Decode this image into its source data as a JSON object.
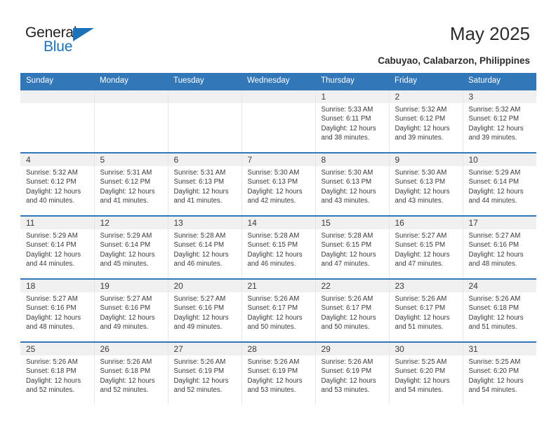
{
  "brand": {
    "name_top": "General",
    "name_bottom": "Blue",
    "triangle_icon": "triangle-icon",
    "accent_color": "#1c72b8"
  },
  "header": {
    "title": "May 2025",
    "subtitle": "Cabuyao, Calabarzon, Philippines"
  },
  "calendar": {
    "header_bg": "#3277b8",
    "daynum_bg": "#f0f0f0",
    "weekdays": [
      "Sunday",
      "Monday",
      "Tuesday",
      "Wednesday",
      "Thursday",
      "Friday",
      "Saturday"
    ],
    "weeks": [
      [
        {
          "day": "",
          "empty": true
        },
        {
          "day": "",
          "empty": true
        },
        {
          "day": "",
          "empty": true
        },
        {
          "day": "",
          "empty": true
        },
        {
          "day": "1",
          "sunrise": "Sunrise: 5:33 AM",
          "sunset": "Sunset: 6:11 PM",
          "daylight1": "Daylight: 12 hours",
          "daylight2": "and 38 minutes."
        },
        {
          "day": "2",
          "sunrise": "Sunrise: 5:32 AM",
          "sunset": "Sunset: 6:12 PM",
          "daylight1": "Daylight: 12 hours",
          "daylight2": "and 39 minutes."
        },
        {
          "day": "3",
          "sunrise": "Sunrise: 5:32 AM",
          "sunset": "Sunset: 6:12 PM",
          "daylight1": "Daylight: 12 hours",
          "daylight2": "and 39 minutes."
        }
      ],
      [
        {
          "day": "4",
          "sunrise": "Sunrise: 5:32 AM",
          "sunset": "Sunset: 6:12 PM",
          "daylight1": "Daylight: 12 hours",
          "daylight2": "and 40 minutes."
        },
        {
          "day": "5",
          "sunrise": "Sunrise: 5:31 AM",
          "sunset": "Sunset: 6:12 PM",
          "daylight1": "Daylight: 12 hours",
          "daylight2": "and 41 minutes."
        },
        {
          "day": "6",
          "sunrise": "Sunrise: 5:31 AM",
          "sunset": "Sunset: 6:13 PM",
          "daylight1": "Daylight: 12 hours",
          "daylight2": "and 41 minutes."
        },
        {
          "day": "7",
          "sunrise": "Sunrise: 5:30 AM",
          "sunset": "Sunset: 6:13 PM",
          "daylight1": "Daylight: 12 hours",
          "daylight2": "and 42 minutes."
        },
        {
          "day": "8",
          "sunrise": "Sunrise: 5:30 AM",
          "sunset": "Sunset: 6:13 PM",
          "daylight1": "Daylight: 12 hours",
          "daylight2": "and 43 minutes."
        },
        {
          "day": "9",
          "sunrise": "Sunrise: 5:30 AM",
          "sunset": "Sunset: 6:13 PM",
          "daylight1": "Daylight: 12 hours",
          "daylight2": "and 43 minutes."
        },
        {
          "day": "10",
          "sunrise": "Sunrise: 5:29 AM",
          "sunset": "Sunset: 6:14 PM",
          "daylight1": "Daylight: 12 hours",
          "daylight2": "and 44 minutes."
        }
      ],
      [
        {
          "day": "11",
          "sunrise": "Sunrise: 5:29 AM",
          "sunset": "Sunset: 6:14 PM",
          "daylight1": "Daylight: 12 hours",
          "daylight2": "and 44 minutes."
        },
        {
          "day": "12",
          "sunrise": "Sunrise: 5:29 AM",
          "sunset": "Sunset: 6:14 PM",
          "daylight1": "Daylight: 12 hours",
          "daylight2": "and 45 minutes."
        },
        {
          "day": "13",
          "sunrise": "Sunrise: 5:28 AM",
          "sunset": "Sunset: 6:14 PM",
          "daylight1": "Daylight: 12 hours",
          "daylight2": "and 46 minutes."
        },
        {
          "day": "14",
          "sunrise": "Sunrise: 5:28 AM",
          "sunset": "Sunset: 6:15 PM",
          "daylight1": "Daylight: 12 hours",
          "daylight2": "and 46 minutes."
        },
        {
          "day": "15",
          "sunrise": "Sunrise: 5:28 AM",
          "sunset": "Sunset: 6:15 PM",
          "daylight1": "Daylight: 12 hours",
          "daylight2": "and 47 minutes."
        },
        {
          "day": "16",
          "sunrise": "Sunrise: 5:27 AM",
          "sunset": "Sunset: 6:15 PM",
          "daylight1": "Daylight: 12 hours",
          "daylight2": "and 47 minutes."
        },
        {
          "day": "17",
          "sunrise": "Sunrise: 5:27 AM",
          "sunset": "Sunset: 6:16 PM",
          "daylight1": "Daylight: 12 hours",
          "daylight2": "and 48 minutes."
        }
      ],
      [
        {
          "day": "18",
          "sunrise": "Sunrise: 5:27 AM",
          "sunset": "Sunset: 6:16 PM",
          "daylight1": "Daylight: 12 hours",
          "daylight2": "and 48 minutes."
        },
        {
          "day": "19",
          "sunrise": "Sunrise: 5:27 AM",
          "sunset": "Sunset: 6:16 PM",
          "daylight1": "Daylight: 12 hours",
          "daylight2": "and 49 minutes."
        },
        {
          "day": "20",
          "sunrise": "Sunrise: 5:27 AM",
          "sunset": "Sunset: 6:16 PM",
          "daylight1": "Daylight: 12 hours",
          "daylight2": "and 49 minutes."
        },
        {
          "day": "21",
          "sunrise": "Sunrise: 5:26 AM",
          "sunset": "Sunset: 6:17 PM",
          "daylight1": "Daylight: 12 hours",
          "daylight2": "and 50 minutes."
        },
        {
          "day": "22",
          "sunrise": "Sunrise: 5:26 AM",
          "sunset": "Sunset: 6:17 PM",
          "daylight1": "Daylight: 12 hours",
          "daylight2": "and 50 minutes."
        },
        {
          "day": "23",
          "sunrise": "Sunrise: 5:26 AM",
          "sunset": "Sunset: 6:17 PM",
          "daylight1": "Daylight: 12 hours",
          "daylight2": "and 51 minutes."
        },
        {
          "day": "24",
          "sunrise": "Sunrise: 5:26 AM",
          "sunset": "Sunset: 6:18 PM",
          "daylight1": "Daylight: 12 hours",
          "daylight2": "and 51 minutes."
        }
      ],
      [
        {
          "day": "25",
          "sunrise": "Sunrise: 5:26 AM",
          "sunset": "Sunset: 6:18 PM",
          "daylight1": "Daylight: 12 hours",
          "daylight2": "and 52 minutes."
        },
        {
          "day": "26",
          "sunrise": "Sunrise: 5:26 AM",
          "sunset": "Sunset: 6:18 PM",
          "daylight1": "Daylight: 12 hours",
          "daylight2": "and 52 minutes."
        },
        {
          "day": "27",
          "sunrise": "Sunrise: 5:26 AM",
          "sunset": "Sunset: 6:19 PM",
          "daylight1": "Daylight: 12 hours",
          "daylight2": "and 52 minutes."
        },
        {
          "day": "28",
          "sunrise": "Sunrise: 5:26 AM",
          "sunset": "Sunset: 6:19 PM",
          "daylight1": "Daylight: 12 hours",
          "daylight2": "and 53 minutes."
        },
        {
          "day": "29",
          "sunrise": "Sunrise: 5:26 AM",
          "sunset": "Sunset: 6:19 PM",
          "daylight1": "Daylight: 12 hours",
          "daylight2": "and 53 minutes."
        },
        {
          "day": "30",
          "sunrise": "Sunrise: 5:25 AM",
          "sunset": "Sunset: 6:20 PM",
          "daylight1": "Daylight: 12 hours",
          "daylight2": "and 54 minutes."
        },
        {
          "day": "31",
          "sunrise": "Sunrise: 5:25 AM",
          "sunset": "Sunset: 6:20 PM",
          "daylight1": "Daylight: 12 hours",
          "daylight2": "and 54 minutes."
        }
      ]
    ]
  }
}
